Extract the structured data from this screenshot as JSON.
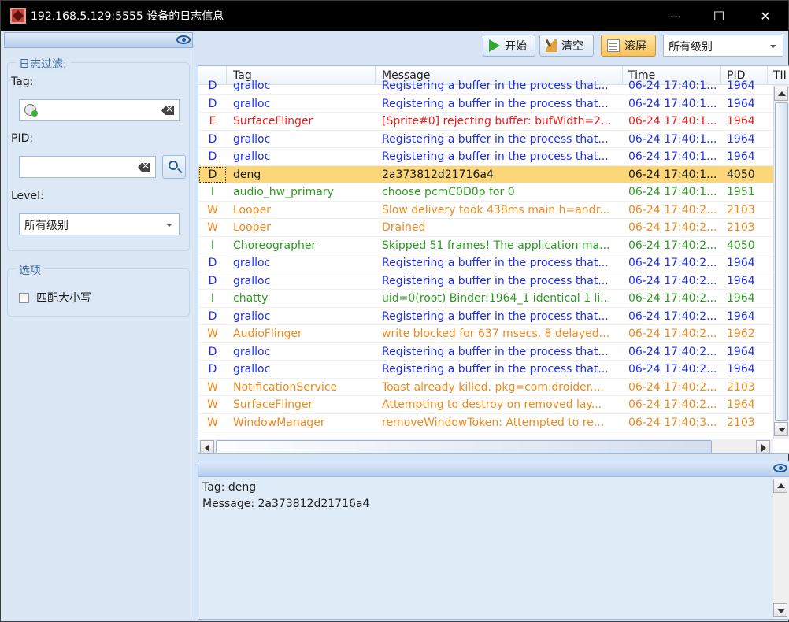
{
  "window": {
    "title": "192.168.5.129:5555 设备的日志信息"
  },
  "filter": {
    "legend": "日志过滤:",
    "tag_label": "Tag:",
    "tag_value": "",
    "pid_label": "PID:",
    "pid_value": "",
    "level_label": "Level:",
    "level_value": "所有级别"
  },
  "options": {
    "legend": "选项",
    "match_case_label": "匹配大小写",
    "match_case_checked": false
  },
  "toolbar": {
    "start_label": "开始",
    "clear_label": "清空",
    "scroll_label": "滚屏",
    "level_value": "所有级别"
  },
  "grid": {
    "columns": [
      "Tag",
      "Message",
      "Time",
      "PID",
      "TII"
    ],
    "rows": [
      {
        "level": "D",
        "tag": "gralloc",
        "message": "Registering a buffer in the process that...",
        "time": "06-24 17:40:1...",
        "pid": "1964"
      },
      {
        "level": "D",
        "tag": "gralloc",
        "message": "Registering a buffer in the process that...",
        "time": "06-24 17:40:1...",
        "pid": "1964"
      },
      {
        "level": "E",
        "tag": "SurfaceFlinger",
        "message": "[Sprite#0] rejecting buffer: bufWidth=2...",
        "time": "06-24 17:40:1...",
        "pid": "1964"
      },
      {
        "level": "D",
        "tag": "gralloc",
        "message": "Registering a buffer in the process that...",
        "time": "06-24 17:40:1...",
        "pid": "1964"
      },
      {
        "level": "D",
        "tag": "gralloc",
        "message": "Registering a buffer in the process that...",
        "time": "06-24 17:40:1...",
        "pid": "1964"
      },
      {
        "level": "D",
        "tag": "deng",
        "message": "2a373812d21716a4",
        "time": "06-24 17:40:1...",
        "pid": "4050",
        "selected": true
      },
      {
        "level": "I",
        "tag": "audio_hw_primary",
        "message": "choose pcmC0D0p for 0",
        "time": "06-24 17:40:1...",
        "pid": "1951"
      },
      {
        "level": "W",
        "tag": "Looper",
        "message": "Slow delivery took 438ms main h=andr...",
        "time": "06-24 17:40:2...",
        "pid": "2103"
      },
      {
        "level": "W",
        "tag": "Looper",
        "message": "Drained",
        "time": "06-24 17:40:2...",
        "pid": "2103"
      },
      {
        "level": "I",
        "tag": "Choreographer",
        "message": "Skipped 51 frames!  The application ma...",
        "time": "06-24 17:40:2...",
        "pid": "4050"
      },
      {
        "level": "D",
        "tag": "gralloc",
        "message": "Registering a buffer in the process that...",
        "time": "06-24 17:40:2...",
        "pid": "1964"
      },
      {
        "level": "D",
        "tag": "gralloc",
        "message": "Registering a buffer in the process that...",
        "time": "06-24 17:40:2...",
        "pid": "1964"
      },
      {
        "level": "I",
        "tag": "chatty",
        "message": "uid=0(root) Binder:1964_1 identical 1 li...",
        "time": "06-24 17:40:2...",
        "pid": "1964"
      },
      {
        "level": "D",
        "tag": "gralloc",
        "message": "Registering a buffer in the process that...",
        "time": "06-24 17:40:2...",
        "pid": "1964"
      },
      {
        "level": "W",
        "tag": "AudioFlinger",
        "message": "write blocked for 637 msecs, 8 delayed...",
        "time": "06-24 17:40:2...",
        "pid": "1962"
      },
      {
        "level": "D",
        "tag": "gralloc",
        "message": "Registering a buffer in the process that...",
        "time": "06-24 17:40:2...",
        "pid": "1964"
      },
      {
        "level": "D",
        "tag": "gralloc",
        "message": "Registering a buffer in the process that...",
        "time": "06-24 17:40:2...",
        "pid": "1964"
      },
      {
        "level": "W",
        "tag": "NotificationService",
        "message": "Toast already killed. pkg=com.droider....",
        "time": "06-24 17:40:2...",
        "pid": "2103"
      },
      {
        "level": "W",
        "tag": "SurfaceFlinger",
        "message": "Attempting to destroy on removed lay...",
        "time": "06-24 17:40:2...",
        "pid": "1964"
      },
      {
        "level": "W",
        "tag": "WindowManager",
        "message": "removeWindowToken: Attempted to re...",
        "time": "06-24 17:40:3...",
        "pid": "2103"
      }
    ]
  },
  "detail": {
    "tag_line": "Tag: deng",
    "message_line": "Message: 2a373812d21716a4"
  },
  "icons": {
    "app": "app-icon",
    "eye": "eye-icon",
    "history": "history-icon",
    "clear": "clear-text-icon",
    "search": "search-icon",
    "play": "play-icon",
    "broom": "broom-icon",
    "scroll": "scroll-icon"
  },
  "colors": {
    "D": "#1f2ff0",
    "E": "#ee1c1c",
    "W": "#f08a1c",
    "I": "#2c9a20",
    "selected": "#fbd77a"
  },
  "window_controls": {
    "minimize": "—",
    "maximize": "☐",
    "close": "✕"
  }
}
